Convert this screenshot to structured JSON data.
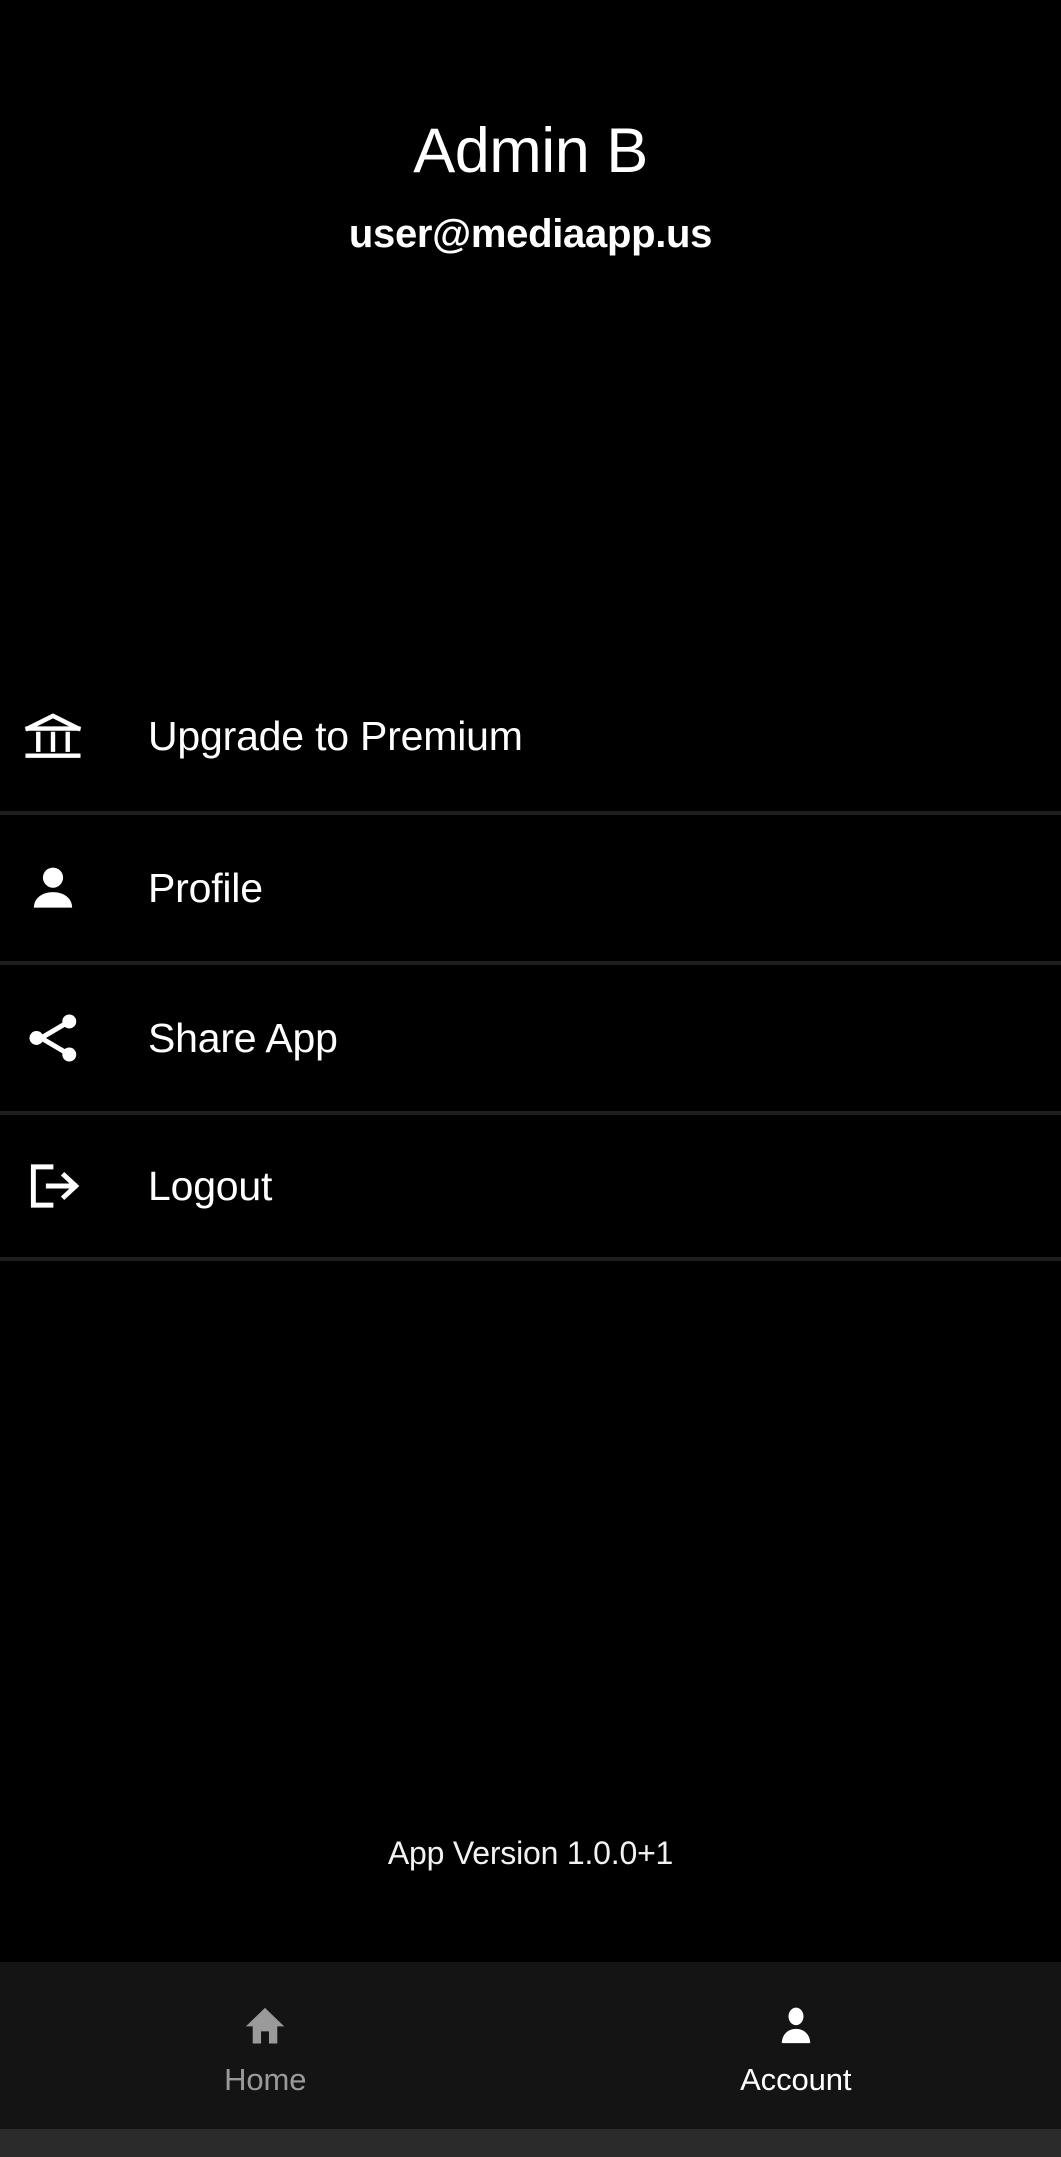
{
  "header": {
    "account_name": "Admin B",
    "account_email": "user@mediaapp.us"
  },
  "menu": {
    "items": [
      {
        "label": "Upgrade to Premium",
        "icon": "bank-icon"
      },
      {
        "label": "Profile",
        "icon": "person-icon"
      },
      {
        "label": "Share App",
        "icon": "share-icon"
      },
      {
        "label": "Logout",
        "icon": "logout-icon"
      }
    ]
  },
  "footer": {
    "version_text": "App Version 1.0.0+1"
  },
  "bottom_nav": {
    "items": [
      {
        "label": "Home",
        "icon": "home-icon",
        "active": false
      },
      {
        "label": "Account",
        "icon": "person-icon",
        "active": true
      }
    ]
  },
  "colors": {
    "background": "#000000",
    "text_primary": "#ffffff",
    "text_inactive": "#9a9a9a",
    "divider": "#1e1e1e",
    "nav_background": "#141414",
    "system_bar": "#2b2b2b"
  }
}
